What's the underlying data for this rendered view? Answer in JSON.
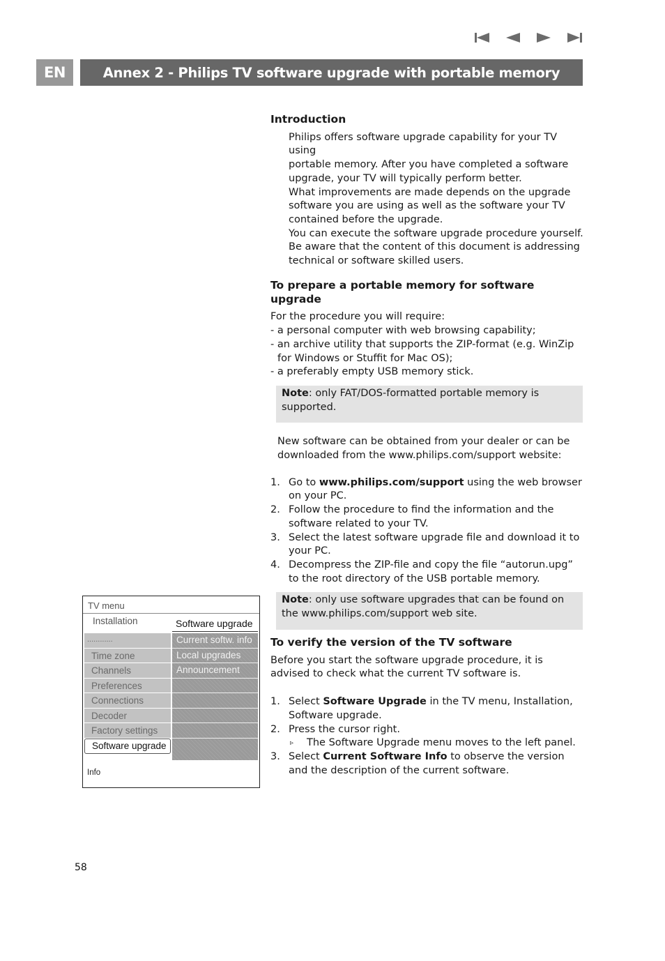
{
  "navigation": {
    "buttons": [
      {
        "name": "first-page",
        "icon": "skip-back-icon"
      },
      {
        "name": "previous-page",
        "icon": "triangle-left-icon"
      },
      {
        "name": "next-page",
        "icon": "triangle-right-icon"
      },
      {
        "name": "last-page",
        "icon": "skip-forward-icon"
      }
    ]
  },
  "header": {
    "language": "EN",
    "title": "Annex 2 - Philips TV software upgrade with portable memory",
    "colors": {
      "language_bg": "#989898",
      "title_bg": "#676767",
      "text": "#ffffff"
    }
  },
  "introduction": {
    "heading": "Introduction",
    "lines": [
      "Philips offers software upgrade capability for your TV using",
      "portable memory. After you have completed a software",
      "upgrade, your TV will typically perform better.",
      "What improvements are made depends on the upgrade",
      "software you are using as well as the software your TV",
      "contained before the upgrade.",
      "You can execute the software upgrade procedure yourself.",
      "Be aware that the content of this document is addressing",
      "technical or software skilled users."
    ]
  },
  "prepare": {
    "heading": "To prepare a portable memory for software upgrade",
    "intro": "For the procedure you will require:",
    "requirements": [
      "- a personal computer with web browsing capability;",
      "- an archive utility that supports the ZIP-format (e.g. WinZip for Windows or Stuffit for Mac OS);",
      "- a preferably empty USB memory stick."
    ],
    "note1": {
      "label": "Note",
      "text": ": only FAT/DOS-formatted portable memory is supported."
    },
    "obtain_text": "New software can be obtained from your dealer or can be downloaded from the www.philips.com/support website:",
    "steps": [
      {
        "num": "1.",
        "pre": "Go to ",
        "bold": "www.philips.com/support",
        "post": " using the web browser on your PC."
      },
      {
        "num": "2.",
        "pre": "Follow the procedure to find the information and the software related to your TV.",
        "bold": "",
        "post": ""
      },
      {
        "num": "3.",
        "pre": "Select the latest software upgrade file and download it to your PC.",
        "bold": "",
        "post": ""
      },
      {
        "num": "4.",
        "pre": "Decompress the ZIP-file and copy the file “autorun.upg” to the root directory of the USB portable memory.",
        "bold": "",
        "post": ""
      }
    ],
    "note2": {
      "label": "Note",
      "text": ": only use software upgrades that can be found on the www.philips.com/support web site."
    }
  },
  "verify": {
    "heading": "To verify the version of the TV software",
    "intro": "Before you start the software upgrade procedure, it is advised to check what the current TV software is.",
    "steps": [
      {
        "num": "1.",
        "pre": "Select ",
        "bold": "Software Upgrade",
        "post": " in the TV menu, Installation, Software upgrade."
      },
      {
        "num": "2.",
        "pre": "Press the cursor right.",
        "bold": "",
        "post": ""
      },
      {
        "num": "3.",
        "pre": "Select ",
        "bold": "Current Software Info",
        "post": " to observe the version and the description of the current software."
      }
    ],
    "substep": {
      "marker": "▹",
      "text": "The Software Upgrade menu moves to the left panel."
    }
  },
  "tv_menu": {
    "title": "TV menu",
    "section": "Installation",
    "right_header": "Software upgrade",
    "left_items": [
      {
        "label": "............",
        "selected": false
      },
      {
        "label": "Time zone",
        "selected": false
      },
      {
        "label": "Channels",
        "selected": false
      },
      {
        "label": "Preferences",
        "selected": false
      },
      {
        "label": "Connections",
        "selected": false
      },
      {
        "label": "Decoder",
        "selected": false
      },
      {
        "label": "Factory settings",
        "selected": false
      },
      {
        "label": "Software upgrade",
        "selected": true
      }
    ],
    "right_items": [
      "Current softw. info",
      "Local upgrades",
      "Announcement",
      "",
      "",
      "",
      "",
      ""
    ],
    "info_label": "Info"
  },
  "footer": {
    "page_number": "58"
  }
}
